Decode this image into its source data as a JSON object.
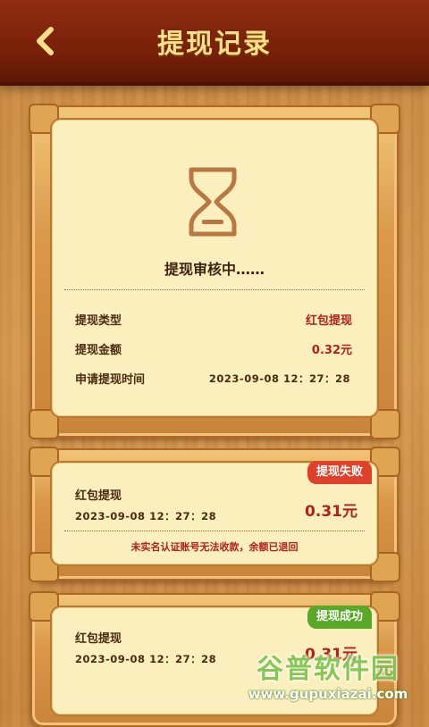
{
  "header": {
    "title": "提现记录"
  },
  "pending": {
    "status_text": "提现审核中……",
    "rows": [
      {
        "label": "提现类型",
        "value": "红包提现"
      },
      {
        "label": "提现金额",
        "value": "0.32元"
      },
      {
        "label": "申请提现时间",
        "value": "2023-09-08 12：27：28"
      }
    ]
  },
  "records": [
    {
      "type": "红包提现",
      "time": "2023-09-08 12：27：28",
      "amount": "0.31元",
      "status": "提现失败",
      "status_color": "#e0402a",
      "note": "未实名认证账号无法收款，余额已退回"
    },
    {
      "type": "红包提现",
      "time": "2023-09-08 12：27：28",
      "amount": "0.31元",
      "status": "提现成功",
      "status_color": "#5aa828"
    }
  ],
  "watermark": {
    "brand": "谷普软件园",
    "url": "www.gupuxiazai.com"
  },
  "colors": {
    "header": "#7a2109",
    "title": "#ffe08a",
    "value_red": "#b3201a",
    "paper": "#fbefbe"
  }
}
